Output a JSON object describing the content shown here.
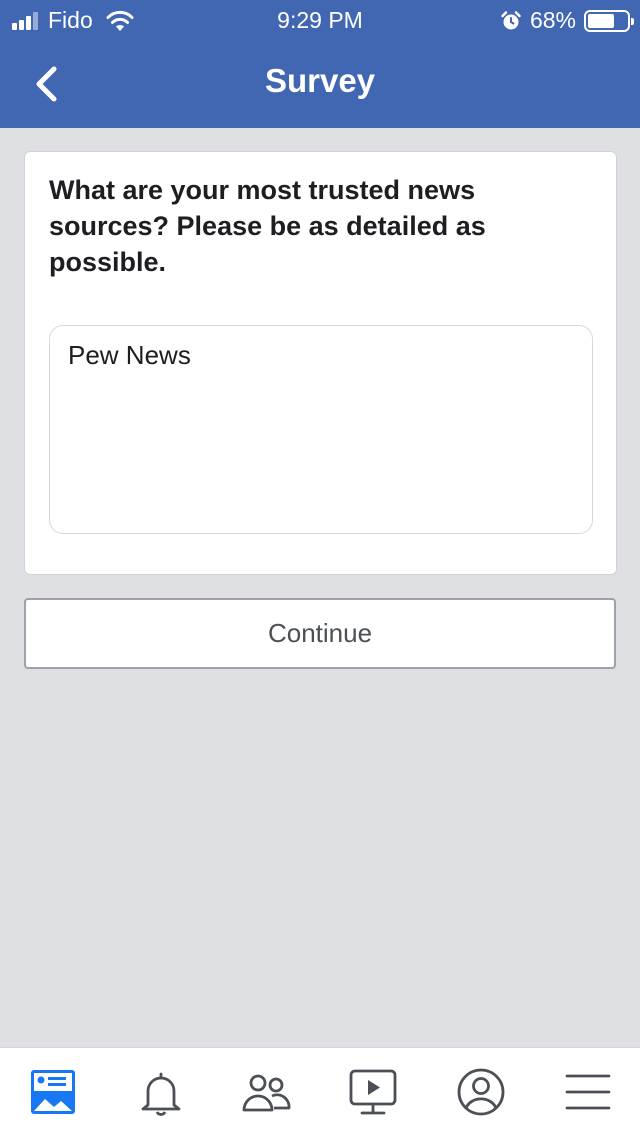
{
  "status_bar": {
    "carrier": "Fido",
    "time": "9:29 PM",
    "battery_percent": "68%",
    "battery_level": 0.68,
    "signal_bars_filled": 3
  },
  "nav": {
    "title": "Survey",
    "back_icon": "chevron-left-icon"
  },
  "survey": {
    "question": "What are your most trusted news sources? Please be as detailed as possible.",
    "answer_value": "Pew News",
    "continue_label": "Continue"
  },
  "tabbar": {
    "tabs": [
      {
        "icon": "news-feed-icon",
        "selected": true
      },
      {
        "icon": "bell-icon",
        "selected": false
      },
      {
        "icon": "friends-icon",
        "selected": false
      },
      {
        "icon": "watch-video-icon",
        "selected": false
      },
      {
        "icon": "profile-icon",
        "selected": false
      },
      {
        "icon": "menu-icon",
        "selected": false
      }
    ]
  },
  "colors": {
    "header_blue": "#4267b2",
    "background": "#dfe0e4",
    "active_tab": "#1877f2"
  }
}
